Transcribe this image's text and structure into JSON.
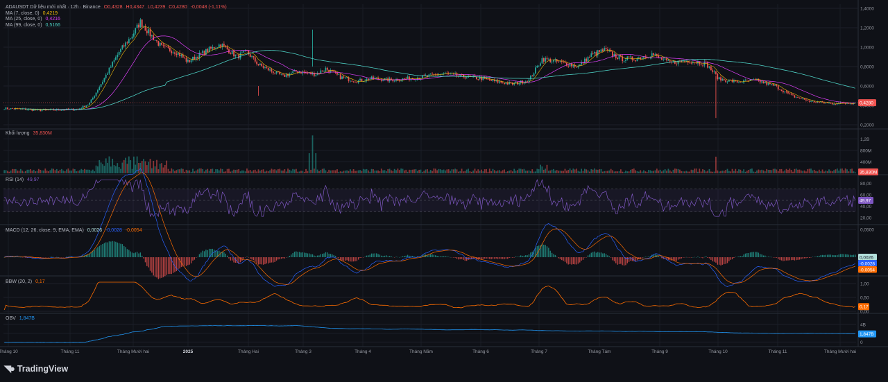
{
  "header": {
    "symbol_line": "ADAUSDT Dữ liệu mới nhất · 12h · Binance",
    "ohlc": {
      "o": "O0,4328",
      "h": "H0,4347",
      "l": "L0,4239",
      "c": "C0,4280",
      "chg": "-0,0048 (-1,11%)"
    },
    "ma7": {
      "label": "MA (7, close, 0)",
      "value": "0,4219"
    },
    "ma25": {
      "label": "MA (25, close, 0)",
      "value": "0,4216"
    },
    "ma99": {
      "label": "MA (99, close, 0)",
      "value": "0,5166"
    }
  },
  "volume_legend": {
    "label": "Khối lượng",
    "value": "35,830M"
  },
  "rsi_legend": {
    "label": "RSI (14)",
    "value": "49,97"
  },
  "macd_legend": {
    "label": "MACD (12, 26, close, 9, EMA, EMA)",
    "v1": "0,0026",
    "v2": "-0,0028",
    "v3": "-0,0054"
  },
  "bbw_legend": {
    "label": "BBW (20, 2)",
    "value": "0,17"
  },
  "obv_legend": {
    "label": "OBV",
    "value": "1,847B"
  },
  "brand": "TradingView",
  "colors": {
    "background": "#0f1117",
    "up": "#26a69a",
    "down": "#ef5350",
    "ma7": "#f0b90b",
    "ma25": "#e040fb",
    "ma99": "#4dd0c4",
    "rsi": "#7e57c2",
    "macd": "#2962ff",
    "signal": "#ff6d00",
    "bbw": "#ff6d00",
    "obv": "#2196f3"
  },
  "chart_data": [
    {
      "type": "candlestick",
      "title": "ADAUSDT · 12h · Binance",
      "x_labels": [
        "Tháng 10",
        "Tháng 11",
        "Tháng Mười hai",
        "2025",
        "Tháng Hai",
        "Tháng 3",
        "Tháng 4",
        "Tháng Năm",
        "Tháng 6",
        "Tháng 7",
        "Tháng Tám",
        "Tháng 9",
        "Tháng 10",
        "Tháng 11",
        "Tháng Mười hai"
      ],
      "y_ticks": [
        "1,4000",
        "1,2000",
        "1,0000",
        "0,8000",
        "0,6000",
        "0,4000",
        "0,2000"
      ],
      "ylim": [
        0.2,
        1.4
      ],
      "last_price_label": "0,4280",
      "series": [
        {
          "name": "price",
          "x": [
            "Tháng 10",
            "Tháng 11",
            "Tháng Mười hai",
            "2025",
            "Tháng Hai",
            "Tháng 3",
            "Tháng 4",
            "Tháng Năm",
            "Tháng 6",
            "Tháng 7",
            "Tháng Tám",
            "Tháng 9",
            "Tháng 10",
            "Tháng 11",
            "Tháng Mười hai"
          ],
          "values": [
            0.37,
            0.36,
            1.05,
            0.88,
            0.77,
            0.76,
            0.63,
            0.73,
            0.67,
            0.62,
            0.95,
            0.84,
            0.85,
            0.66,
            0.428
          ]
        },
        {
          "name": "MA (7, close, 0)",
          "last": 0.4219
        },
        {
          "name": "MA (25, close, 0)",
          "last": 0.4216
        },
        {
          "name": "MA (99, close, 0)",
          "values": [
            0.36,
            0.37,
            0.55,
            0.9,
            0.98,
            0.88,
            0.78,
            0.72,
            0.7,
            0.68,
            0.71,
            0.78,
            0.8,
            0.7,
            0.5166
          ]
        }
      ]
    },
    {
      "type": "bar",
      "title": "Khối lượng",
      "y_ticks": [
        "1,2B",
        "800M",
        "400M"
      ],
      "ylim": [
        0,
        1400000000
      ],
      "last_label": "35,830M",
      "last_value": 35830000
    },
    {
      "type": "line",
      "title": "RSI (14)",
      "y_ticks": [
        "80,00",
        "60,00",
        "40,00",
        "20,00"
      ],
      "ylim": [
        10,
        90
      ],
      "band": [
        30,
        70
      ],
      "middle": 50,
      "last_label": "49,97",
      "last_value": 49.97
    },
    {
      "type": "line",
      "title": "MACD (12, 26, close, 9, EMA, EMA)",
      "y_ticks": [
        "0,0500"
      ],
      "series_last": [
        {
          "name": "histogram",
          "label": "0,0026",
          "value": 0.0026
        },
        {
          "name": "MACD",
          "label": "-0,0028",
          "value": -0.0028
        },
        {
          "name": "signal",
          "label": "-0,0054",
          "value": -0.0054
        }
      ]
    },
    {
      "type": "line",
      "title": "BBW (20, 2)",
      "y_ticks": [
        "1,00",
        "0,50",
        "0,00"
      ],
      "ylim": [
        0,
        1.1
      ],
      "last_label": "0,17",
      "last_value": 0.17
    },
    {
      "type": "line",
      "title": "OBV",
      "y_ticks": [
        "4B",
        "2B",
        "0"
      ],
      "ylim": [
        -0.3,
        5
      ],
      "last_label": "1,847B",
      "last_value": 1.847
    }
  ]
}
